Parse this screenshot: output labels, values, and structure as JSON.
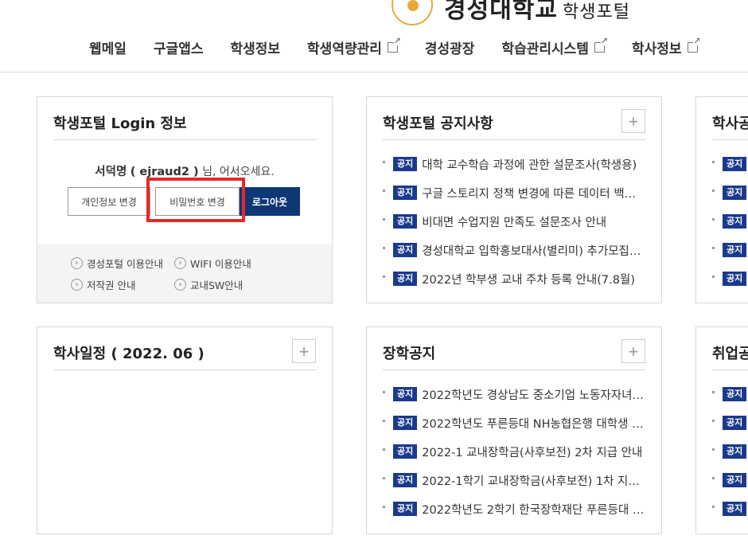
{
  "header": {
    "logo_text": "경성대학교",
    "logo_sub": "학생포털",
    "nav": [
      {
        "label": "웹메일",
        "external": false
      },
      {
        "label": "구글앱스",
        "external": false
      },
      {
        "label": "학생정보",
        "external": false
      },
      {
        "label": "학생역량관리",
        "external": true
      },
      {
        "label": "경성광장",
        "external": false
      },
      {
        "label": "학습관리시스템",
        "external": true
      },
      {
        "label": "학사정보",
        "external": true
      }
    ]
  },
  "login": {
    "title": "학생포털 Login 정보",
    "user_name": "서덕명",
    "user_id": "( ejraud2 )",
    "greeting": "님, 어서오세요.",
    "btn_info": "개인정보 변경",
    "btn_password": "비밀번호 변경",
    "btn_logout": "로그아웃",
    "guides": [
      "경성포털 이용안내",
      "WIFI 이용안내",
      "저작권 안내",
      "교내SW안내"
    ]
  },
  "notice": {
    "title": "학생포털 공지사항",
    "badge": "공지",
    "items": [
      "대학 교수학습 과정에 관한 설문조사(학생용)",
      "구글 스토리지 정책 변경에 따른 데이터 백…",
      "비대면 수업지원 만족도 설문조사 안내",
      "경성대학교 입학홍보대사(별리미) 추가모집…",
      "2022년 학부생 교내 주차 등록 안내(7.8월)"
    ]
  },
  "right_top": {
    "title": "학사공",
    "badge": "공지"
  },
  "schedule": {
    "title": "학사일정 ( 2022. 06 )"
  },
  "scholarship": {
    "title": "장학공지",
    "badge": "공지",
    "items": [
      "2022학년도 경상남도 중소기업 노동자자녀…",
      "2022학년도 푸른등대 NH농협은행 대학생 …",
      "2022-1 교내장학금(사후보전) 2차 지급 안내",
      "2022-1학기 교내장학금(사후보전) 1차 지…",
      "2022학년도 2학기 한국장학재단 푸른등대 …"
    ]
  },
  "right_bottom": {
    "title": "취업공",
    "badge": "공지"
  },
  "colors": {
    "badge": "#1b3a8c",
    "logout": "#0d3775",
    "highlight": "#e32b2b"
  }
}
